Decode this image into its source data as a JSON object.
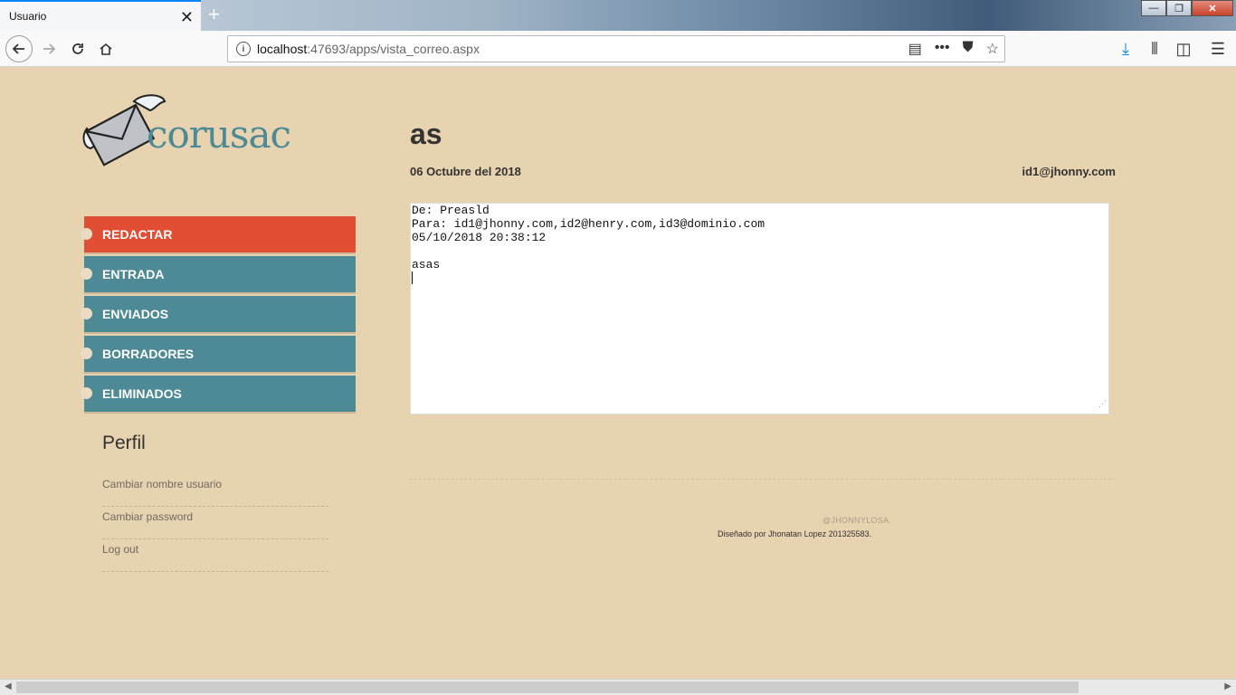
{
  "browser": {
    "tab_title": "Usuario",
    "tab_close": "✕",
    "new_tab": "+",
    "url_host": "localhost",
    "url_rest": ":47693/apps/vista_correo.aspx"
  },
  "brand": {
    "name": "corusac"
  },
  "menu": {
    "items": [
      {
        "label": "REDACTAR"
      },
      {
        "label": "ENTRADA"
      },
      {
        "label": "ENVIADOS"
      },
      {
        "label": "BORRADORES"
      },
      {
        "label": "ELIMINADOS"
      }
    ]
  },
  "profile": {
    "title": "Perfil",
    "links": [
      {
        "label": "Cambiar nombre usuario"
      },
      {
        "label": "Cambiar password"
      },
      {
        "label": "Log out"
      }
    ]
  },
  "message": {
    "subject": "as",
    "date": "06 Octubre del 2018",
    "account": "id1@jhonny.com",
    "body_lines": [
      "De: Preasld",
      "Para: id1@jhonny.com,id2@henry.com,id3@dominio.com",
      "05/10/2018 20:38:12",
      "",
      "asas"
    ]
  },
  "footer": {
    "handle": "@JHONNYLOSA.",
    "credit": "Diseñado por Jhonatan Lopez 201325583."
  },
  "colors": {
    "accent_active": "#e14e33",
    "menu_teal": "#4d8a96",
    "page_bg": "#e8d3b0"
  }
}
